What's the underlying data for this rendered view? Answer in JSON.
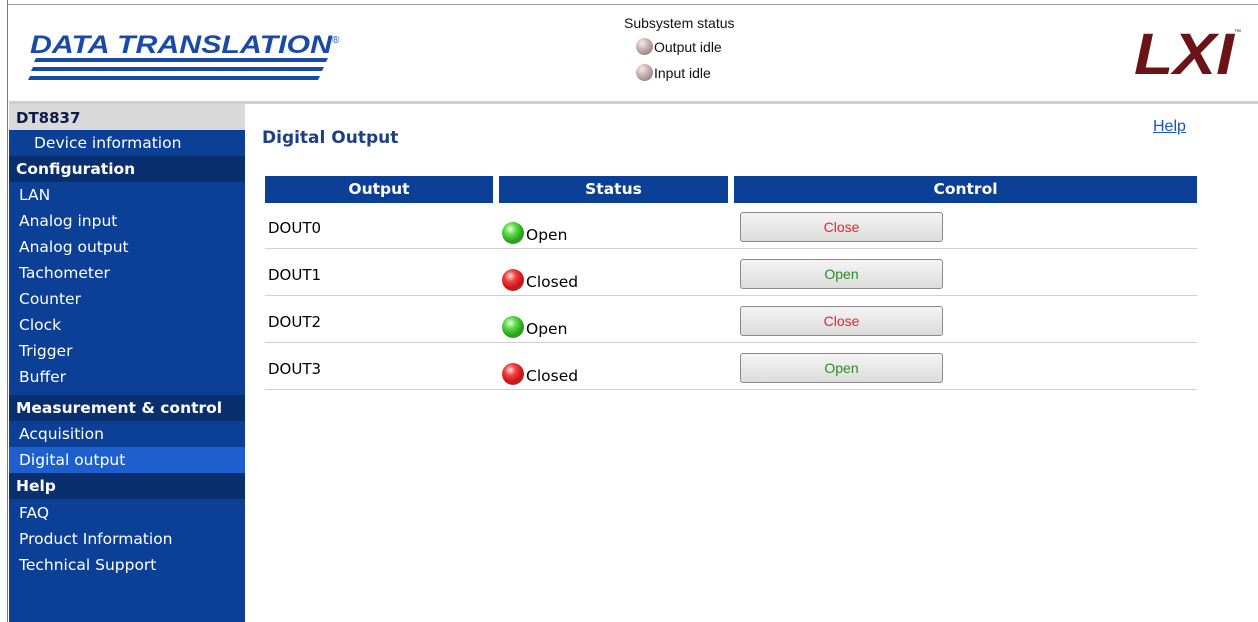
{
  "header": {
    "brand": "DATA TRANSLATION",
    "subsystem": {
      "title": "Subsystem status",
      "output": "Output idle",
      "input": "Input idle"
    },
    "lxi": "LXI"
  },
  "sidebar": {
    "device": "DT8837",
    "sections": [
      {
        "label": "Configuration",
        "items": [
          "LAN",
          "Analog input",
          "Analog output",
          "Tachometer",
          "Counter",
          "Clock",
          "Trigger",
          "Buffer"
        ]
      },
      {
        "label": "Measurement & control",
        "items": [
          "Acquisition",
          "Digital output"
        ]
      },
      {
        "label": "Help",
        "items": [
          "FAQ",
          "Product Information",
          "Technical Support"
        ]
      }
    ],
    "device_info": "Device information",
    "active_item": "Digital output"
  },
  "main": {
    "title": "Digital Output",
    "help": "Help",
    "columns": [
      "Output",
      "Status",
      "Control"
    ],
    "rows": [
      {
        "output": "DOUT0",
        "status": "Open",
        "status_color": "green",
        "control": "Close"
      },
      {
        "output": "DOUT1",
        "status": "Closed",
        "status_color": "red",
        "control": "Open"
      },
      {
        "output": "DOUT2",
        "status": "Open",
        "status_color": "green",
        "control": "Close"
      },
      {
        "output": "DOUT3",
        "status": "Closed",
        "status_color": "red",
        "control": "Open"
      }
    ]
  },
  "colors": {
    "nav_blue": "#0c3f96",
    "nav_section": "#0a2f6e",
    "active_item": "#1d5fcc",
    "title_blue": "#1e3f82",
    "close_red": "#e4262d",
    "open_green": "#2a8a25"
  }
}
